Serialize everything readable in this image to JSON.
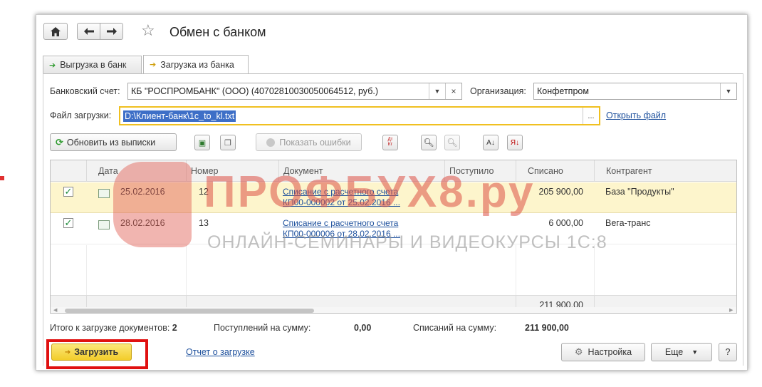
{
  "window": {
    "title": "Обмен с банком"
  },
  "nav": {
    "home_icon": "home-icon",
    "back_icon": "arrow-left-icon",
    "forward_icon": "arrow-right-icon",
    "favorite_icon": "star-icon"
  },
  "tabs": [
    {
      "label": "Выгрузка в банк",
      "icon": "arrow-out-icon"
    },
    {
      "label": "Загрузка из банка",
      "icon": "arrow-in-icon",
      "active": true
    }
  ],
  "form": {
    "bank_account_label": "Банковский счет:",
    "bank_account_value": "КБ \"РОСПРОМБАНК\" (ООО) (40702810030050064512, руб.)",
    "organization_label": "Организация:",
    "organization_value": "Конфетпром",
    "file_label": "Файл загрузки:",
    "file_value": "D:\\Клиент-банк\\1c_to_kl.txt",
    "file_browse": "...",
    "open_file_link": "Открыть файл"
  },
  "toolbar": {
    "refresh_label": "Обновить из выписки",
    "show_errors_label": "Показать ошибки",
    "dt_kt": "Дт Кт"
  },
  "table": {
    "columns": [
      "Дата",
      "Номер",
      "Документ",
      "Поступило",
      "Списано",
      "Контрагент"
    ],
    "rows": [
      {
        "date": "25.02.2016",
        "number": "12",
        "doc_line1": "Списание с расчетного счета",
        "doc_line2": "КП00-000002 от 25.02.2016 ...",
        "received": "",
        "written_off": "205 900,00",
        "counterparty": "База \"Продукты\""
      },
      {
        "date": "28.02.2016",
        "number": "13",
        "doc_line1": "Списание с расчетного счета",
        "doc_line2": "КП00-000006 от 28.02.2016 ...",
        "received": "",
        "written_off": "6 000,00",
        "counterparty": "Вега-транс"
      }
    ],
    "total_written_off": "211 900,00"
  },
  "summary": {
    "docs_label": "Итого к загрузке документов:",
    "docs_value": "2",
    "received_label": "Поступлений на сумму:",
    "received_value": "0,00",
    "written_off_label": "Списаний на сумму:",
    "written_off_value": "211 900,00"
  },
  "footer": {
    "load_label": "Загрузить",
    "report_link": "Отчет о загрузке",
    "settings_label": "Настройка",
    "more_label": "Еще",
    "help_label": "?"
  },
  "watermark": {
    "line1": "ПРОФБУХ8.ру",
    "line2": "ОНЛАЙН-СЕМИНАРЫ И ВИДЕОКУРСЫ 1С:8"
  },
  "colors": {
    "selected_row": "#fdf5cc",
    "focus_border": "#f0c020",
    "highlight_box": "#e01010",
    "link": "#1c4f9c",
    "load_button": "#f6d53a"
  }
}
